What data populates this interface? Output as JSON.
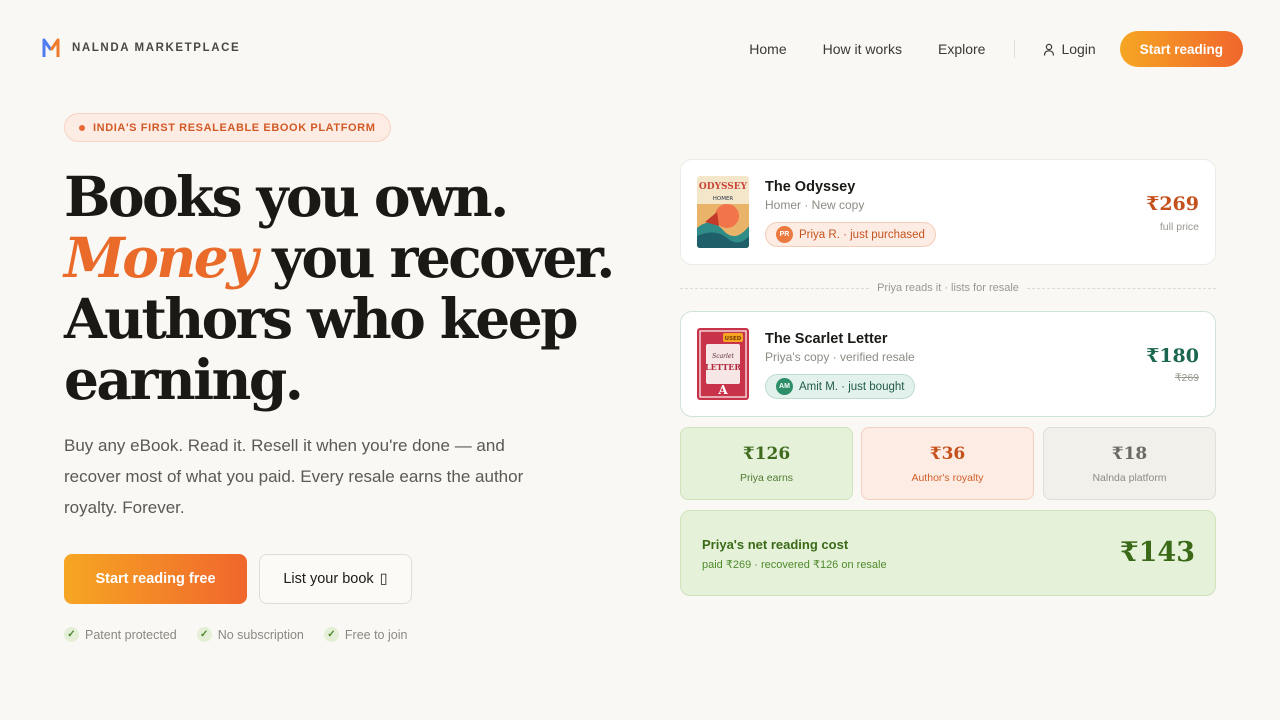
{
  "brand": {
    "name": "NALNDA MARKETPLACE"
  },
  "nav": {
    "links": [
      "Home",
      "How it works",
      "Explore"
    ],
    "login": "Login",
    "start": "Start reading"
  },
  "hero": {
    "pill": "INDIA'S FIRST RESALEABLE EBOOK PLATFORM",
    "line1": "Books you own.",
    "line2_accent": "Money",
    "line2_rest": " you recover.",
    "line3": "Authors who keep",
    "line4": "earning.",
    "sub": "Buy any eBook. Read it. Resell it when you're done — and recover most of what you paid. Every resale earns the author royalty. Forever.",
    "cta_primary": "Start reading free",
    "cta_secondary": "List your book",
    "cta_secondary_icon": "▯",
    "checks": [
      "Patent protected",
      "No subscription",
      "Free to join"
    ]
  },
  "flow": {
    "card1": {
      "title": "The Odyssey",
      "meta": "Homer · New copy",
      "buyer_initials": "PR",
      "buyer": "Priya R. · just purchased",
      "price": "₹269",
      "note": "full price"
    },
    "divider": "Priya reads it · lists for resale",
    "card2": {
      "title": "The Scarlet Letter",
      "meta": "Priya's copy · verified resale",
      "buyer_initials": "AM",
      "buyer": "Amit M. · just bought",
      "price": "₹180",
      "old_price": "₹269"
    },
    "split": [
      {
        "amount": "₹126",
        "label": "Priya earns"
      },
      {
        "amount": "₹36",
        "label": "Author's royalty"
      },
      {
        "amount": "₹18",
        "label": "Nalnda platform"
      }
    ],
    "net": {
      "title": "Priya's net reading cost",
      "sub": "paid ₹269 · recovered ₹126 on resale",
      "amount": "₹143"
    }
  },
  "colors": {
    "accent": "#ea6a29",
    "green": "#3a6a17",
    "teal": "#1b6650"
  }
}
